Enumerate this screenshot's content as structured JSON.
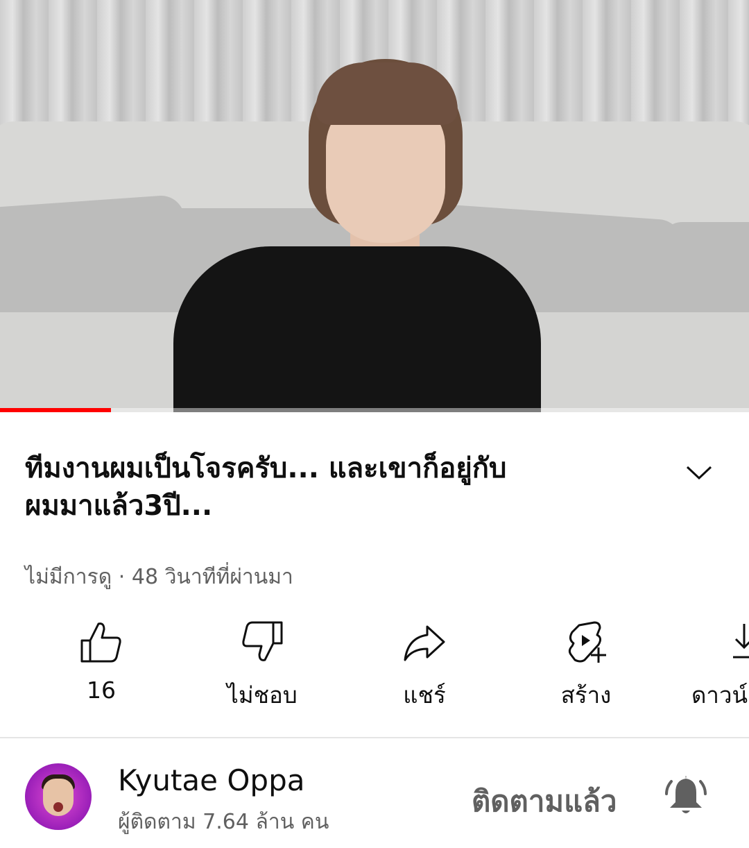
{
  "video": {
    "progress_fraction": 0.148,
    "progress_color": "#ff0000"
  },
  "title": {
    "line1": "ทีมงานผมเป็นโจรครับ... และเขาก็อยู่กับ",
    "line2": "ผมมาแล้ว3ปี..."
  },
  "meta": {
    "text": "ไม่มีการดู · 48 วินาทีที่ผ่านมา"
  },
  "actions": [
    {
      "label": "16",
      "icon": "like-icon"
    },
    {
      "label": "ไม่ชอบ",
      "icon": "dislike-icon"
    },
    {
      "label": "แชร์",
      "icon": "share-icon"
    },
    {
      "label": "สร้าง",
      "icon": "create-icon"
    },
    {
      "label": "ดาวน์",
      "icon": "download-icon"
    }
  ],
  "channel": {
    "name": "Kyutae Oppa",
    "subscribers": "ผู้ติดตาม 7.64 ล้าน คน",
    "subscribe_label": "ติดตามแล้ว",
    "bell_icon": "bell-icon"
  }
}
